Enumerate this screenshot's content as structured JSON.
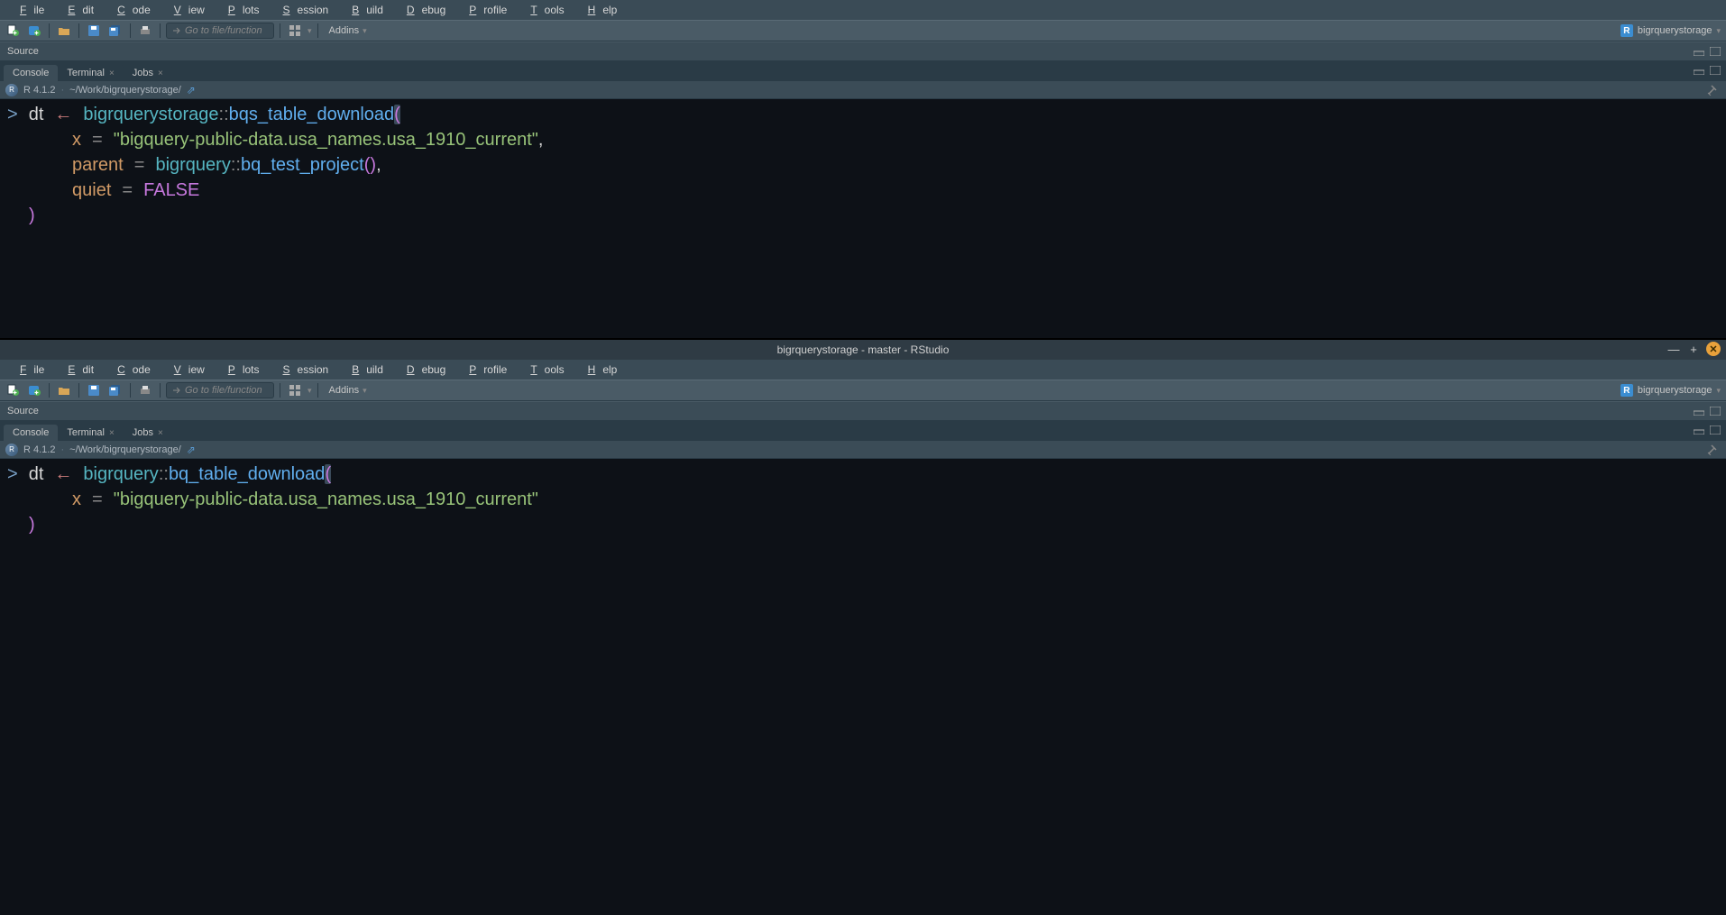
{
  "menus": [
    "File",
    "Edit",
    "Code",
    "View",
    "Plots",
    "Session",
    "Build",
    "Debug",
    "Profile",
    "Tools",
    "Help"
  ],
  "toolbar": {
    "goto_placeholder": "Go to file/function",
    "addins_label": "Addins",
    "project_name": "bigrquerystorage"
  },
  "tabs": {
    "console": "Console",
    "terminal": "Terminal",
    "jobs": "Jobs"
  },
  "source_label": "Source",
  "status": {
    "r_version": "R 4.1.2",
    "wd": "~/Work/bigrquerystorage/"
  },
  "window2_title": "bigrquerystorage - master - RStudio",
  "code1": {
    "l1": {
      "prompt": ">",
      "dt": "dt",
      "arrow": "←",
      "pkg": "bigrquerystorage",
      "dc": "::",
      "fn": "bqs_table_download",
      "op": "("
    },
    "l2": {
      "arg": "x",
      "eq": "=",
      "str": "\"bigquery-public-data.usa_names.usa_1910_current\"",
      "comma": ","
    },
    "l3": {
      "arg": "parent",
      "eq": "=",
      "pkg": "bigrquery",
      "dc": "::",
      "fn": "bq_test_project",
      "op": "(",
      "cp": ")",
      "comma": ","
    },
    "l4": {
      "arg": "quiet",
      "eq": "=",
      "val": "FALSE"
    },
    "l5": {
      "cp": ")"
    }
  },
  "code2": {
    "l1": {
      "prompt": ">",
      "dt": "dt",
      "arrow": "←",
      "pkg": "bigrquery",
      "dc": "::",
      "fn": "bq_table_download",
      "op": "("
    },
    "l2": {
      "arg": "x",
      "eq": "=",
      "str": "\"bigquery-public-data.usa_names.usa_1910_current\""
    },
    "l3": {
      "cp": ")"
    }
  }
}
